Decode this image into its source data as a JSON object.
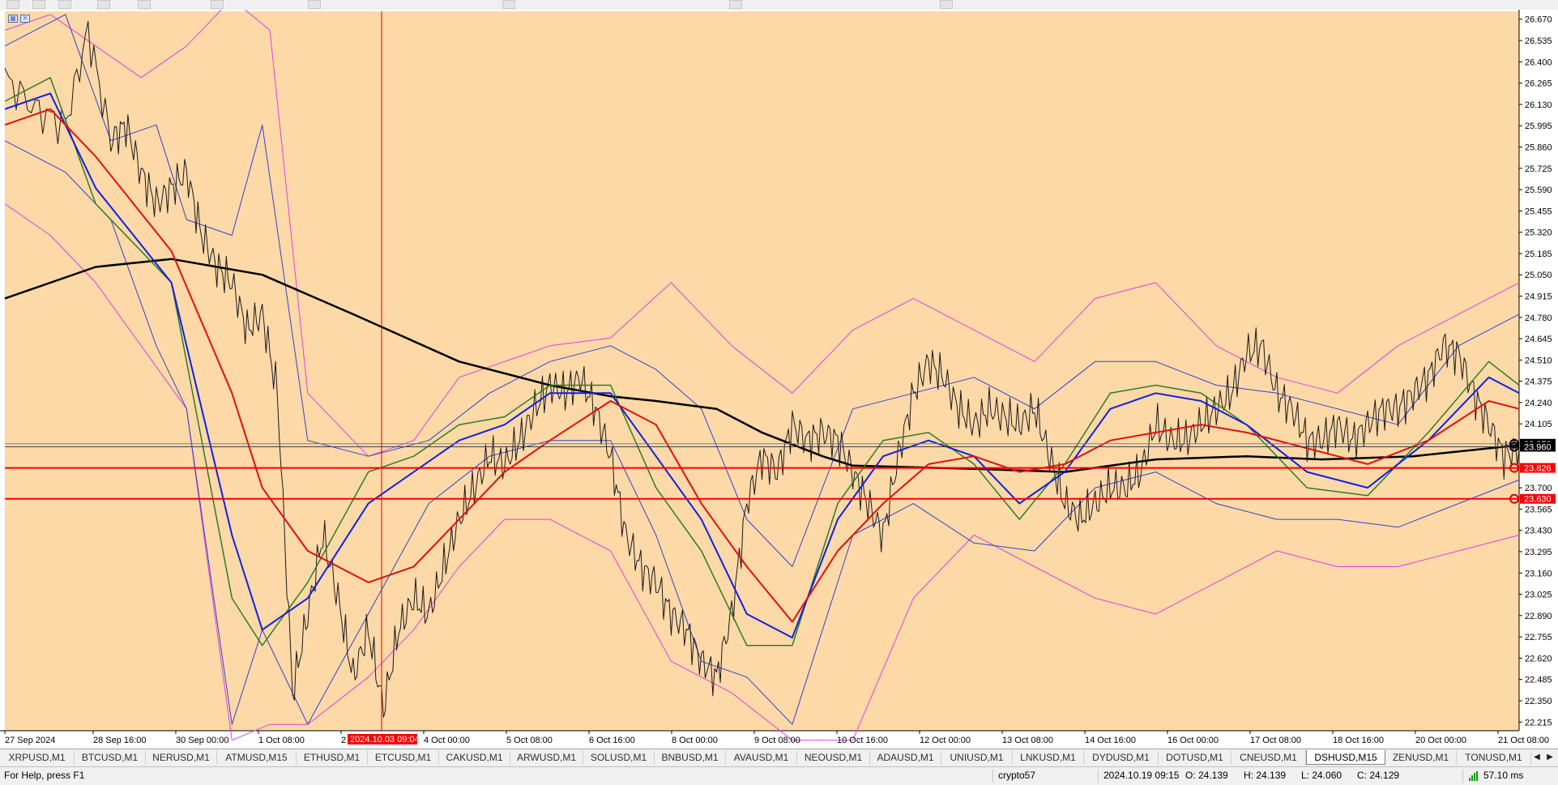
{
  "colors": {
    "chart_bg": "#fdd9a8",
    "price_line": "#1a1a1a",
    "ema_fast_green": "#2e7d1e",
    "ema_blue": "#1020e0",
    "ema_red": "#e01010",
    "sma_black": "#000000",
    "bollinger_inner": "#3040d0",
    "bollinger_outer": "#e040e0",
    "hline_red": "#ff0000",
    "crosshair": "#e00000"
  },
  "chart_data": {
    "type": "line",
    "symbol": "DSHUSD",
    "timeframe": "M15",
    "y_axis_labels": [
      "26.670",
      "26.535",
      "26.400",
      "26.265",
      "26.130",
      "25.995",
      "25.860",
      "25.725",
      "25.590",
      "25.455",
      "25.320",
      "25.185",
      "25.050",
      "24.915",
      "24.780",
      "24.645",
      "24.510",
      "24.375",
      "24.240",
      "24.105",
      "23.700",
      "23.565",
      "23.430",
      "23.295",
      "23.160",
      "23.025",
      "22.890",
      "22.755",
      "22.620",
      "22.485",
      "22.350",
      "22.215"
    ],
    "ylim": [
      22.16,
      26.72
    ],
    "x_axis_labels": [
      "27 Sep 2024",
      "28 Sep 16:00",
      "30 Sep 00:00",
      "1 Oct 08:00",
      "2",
      "4 Oct 00:00",
      "5 Oct 08:00",
      "6 Oct 16:00",
      "8 Oct 00:00",
      "9 Oct 08:00",
      "10 Oct 16:00",
      "12 Oct 00:00",
      "13 Oct 08:00",
      "14 Oct 16:00",
      "16 Oct 00:00",
      "17 Oct 08:00",
      "18 Oct 16:00",
      "20 Oct 00:00",
      "21 Oct 08:00"
    ],
    "price_tags": [
      {
        "label": "23.979",
        "color": "#000000",
        "text_color": "#ffffff"
      },
      {
        "label": "23.960",
        "color": "#000000",
        "text_color": "#ffffff"
      },
      {
        "label": "23.826",
        "color": "#ff0000",
        "text_color": "#ffffff"
      },
      {
        "label": "23.630",
        "color": "#ff0000",
        "text_color": "#ffffff"
      }
    ],
    "horizontal_lines": [
      {
        "price": 23.979,
        "color": "#808080"
      },
      {
        "price": 23.96,
        "color": "#404040"
      },
      {
        "price": 23.826,
        "color": "#ff0000"
      },
      {
        "price": 23.63,
        "color": "#ff0000"
      }
    ],
    "crosshair_label": "2024.10.03 09:04",
    "series": [
      {
        "role": "price",
        "x": [
          0,
          20,
          40,
          55,
          70,
          80,
          90,
          100,
          110,
          120,
          130,
          140,
          150,
          160,
          170,
          180,
          190,
          200,
          210,
          220,
          230,
          240,
          250,
          260,
          270,
          280,
          290,
          300,
          310,
          320,
          330,
          340,
          350,
          360,
          370,
          380,
          390,
          400,
          410,
          420,
          430,
          440,
          450,
          460,
          470,
          480,
          490,
          500,
          510,
          520,
          530,
          540,
          550,
          560,
          570,
          580,
          590,
          600,
          610,
          620,
          630,
          640,
          650,
          660,
          670,
          680,
          690,
          700,
          710,
          720,
          730,
          740,
          750,
          760,
          770,
          780,
          790,
          800,
          810,
          820,
          830,
          840,
          850,
          860,
          870,
          880,
          890,
          900,
          910,
          920,
          930,
          940,
          950,
          960,
          970,
          980,
          990,
          1000
        ],
        "values": [
          26.3,
          26.1,
          26.0,
          26.6,
          25.9,
          26.0,
          25.7,
          25.5,
          25.6,
          25.7,
          25.3,
          25.1,
          25.0,
          24.7,
          24.8,
          24.3,
          22.4,
          22.9,
          23.4,
          23.0,
          22.5,
          22.8,
          22.3,
          22.8,
          23.0,
          22.9,
          23.2,
          23.5,
          23.7,
          23.9,
          23.85,
          24.0,
          24.2,
          24.35,
          24.3,
          24.4,
          24.2,
          23.9,
          23.4,
          23.2,
          23.1,
          22.9,
          22.8,
          22.6,
          22.5,
          22.9,
          23.6,
          23.9,
          23.8,
          24.1,
          24.0,
          24.05,
          24.0,
          23.8,
          23.6,
          23.4,
          23.9,
          24.3,
          24.5,
          24.4,
          24.2,
          24.1,
          24.2,
          24.15,
          24.1,
          24.2,
          23.9,
          23.6,
          23.5,
          23.6,
          23.7,
          23.7,
          23.8,
          24.1,
          24.0,
          24.0,
          24.1,
          24.2,
          24.3,
          24.55,
          24.6,
          24.3,
          24.2,
          24.0,
          24.0,
          24.1,
          24.0,
          24.1,
          24.2,
          24.2,
          24.3,
          24.4,
          24.6,
          24.55,
          24.3,
          24.1,
          23.9,
          23.95
        ]
      },
      {
        "role": "sma_long",
        "x": [
          0,
          60,
          110,
          170,
          230,
          300,
          360,
          400,
          430,
          470,
          500,
          540,
          560,
          600,
          640,
          700,
          760,
          820,
          870,
          930,
          1000
        ],
        "values": [
          24.9,
          25.1,
          25.15,
          25.05,
          24.8,
          24.5,
          24.35,
          24.28,
          24.25,
          24.2,
          24.05,
          23.9,
          23.84,
          23.83,
          23.82,
          23.8,
          23.88,
          23.9,
          23.88,
          23.9,
          23.97
        ]
      },
      {
        "role": "ema_red",
        "x": [
          0,
          30,
          60,
          110,
          150,
          170,
          200,
          240,
          270,
          300,
          330,
          360,
          400,
          430,
          460,
          490,
          520,
          550,
          580,
          610,
          640,
          670,
          700,
          730,
          760,
          790,
          820,
          860,
          900,
          940,
          980,
          1000
        ],
        "values": [
          26.0,
          26.1,
          25.8,
          25.2,
          24.3,
          23.7,
          23.3,
          23.1,
          23.2,
          23.5,
          23.8,
          24.0,
          24.25,
          24.1,
          23.6,
          23.2,
          22.85,
          23.3,
          23.6,
          23.85,
          23.9,
          23.8,
          23.85,
          24.0,
          24.05,
          24.1,
          24.05,
          23.95,
          23.85,
          24.0,
          24.25,
          24.2
        ]
      },
      {
        "role": "ema_blue",
        "x": [
          0,
          30,
          60,
          110,
          150,
          170,
          200,
          240,
          270,
          300,
          330,
          360,
          400,
          430,
          460,
          490,
          520,
          550,
          580,
          610,
          640,
          670,
          700,
          730,
          760,
          790,
          820,
          860,
          900,
          940,
          980,
          1000
        ],
        "values": [
          26.1,
          26.2,
          25.6,
          25.0,
          23.4,
          22.8,
          23.0,
          23.6,
          23.8,
          24.0,
          24.1,
          24.3,
          24.3,
          23.9,
          23.5,
          22.9,
          22.75,
          23.5,
          23.9,
          24.0,
          23.9,
          23.6,
          23.8,
          24.2,
          24.3,
          24.25,
          24.1,
          23.8,
          23.7,
          24.0,
          24.4,
          24.3
        ]
      },
      {
        "role": "ema_green",
        "x": [
          0,
          30,
          60,
          110,
          150,
          170,
          200,
          240,
          270,
          300,
          330,
          360,
          400,
          430,
          460,
          490,
          520,
          550,
          580,
          610,
          640,
          670,
          700,
          730,
          760,
          790,
          820,
          860,
          900,
          940,
          980,
          1000
        ],
        "values": [
          26.15,
          26.3,
          25.5,
          25.0,
          23.0,
          22.7,
          23.1,
          23.8,
          23.9,
          24.1,
          24.15,
          24.35,
          24.35,
          23.7,
          23.3,
          22.7,
          22.7,
          23.6,
          24.0,
          24.05,
          23.85,
          23.5,
          23.85,
          24.3,
          24.35,
          24.3,
          24.1,
          23.7,
          23.65,
          24.05,
          24.5,
          24.35
        ]
      },
      {
        "role": "bollinger_inner_upper",
        "x": [
          0,
          40,
          70,
          100,
          120,
          150,
          170,
          200,
          240,
          280,
          320,
          360,
          400,
          430,
          460,
          490,
          520,
          560,
          600,
          640,
          680,
          720,
          760,
          800,
          840,
          880,
          920,
          960,
          1000
        ],
        "values": [
          26.5,
          26.7,
          25.9,
          26.0,
          25.4,
          25.3,
          26.0,
          24.0,
          23.9,
          24.0,
          24.3,
          24.5,
          24.6,
          24.45,
          24.2,
          23.5,
          23.2,
          24.2,
          24.3,
          24.4,
          24.2,
          24.5,
          24.5,
          24.35,
          24.3,
          24.2,
          24.1,
          24.6,
          24.8
        ]
      },
      {
        "role": "bollinger_inner_lower",
        "x": [
          0,
          40,
          70,
          100,
          120,
          150,
          170,
          200,
          240,
          280,
          320,
          360,
          400,
          430,
          460,
          490,
          520,
          560,
          600,
          640,
          680,
          720,
          760,
          800,
          840,
          880,
          920,
          960,
          1000
        ],
        "values": [
          25.9,
          25.7,
          25.4,
          24.6,
          24.2,
          22.2,
          22.8,
          22.2,
          22.9,
          23.6,
          23.9,
          24.0,
          24.0,
          23.4,
          22.6,
          22.5,
          22.2,
          23.4,
          23.6,
          23.35,
          23.3,
          23.7,
          23.8,
          23.6,
          23.5,
          23.5,
          23.45,
          23.6,
          23.75
        ]
      },
      {
        "role": "bollinger_outer_upper",
        "x": [
          0,
          30,
          60,
          90,
          120,
          150,
          175,
          200,
          240,
          270,
          300,
          330,
          360,
          400,
          440,
          480,
          520,
          560,
          600,
          640,
          680,
          720,
          760,
          800,
          840,
          880,
          920,
          960,
          1000
        ],
        "values": [
          26.6,
          26.7,
          26.5,
          26.3,
          26.5,
          26.8,
          26.6,
          24.3,
          23.9,
          24.0,
          24.4,
          24.5,
          24.6,
          24.65,
          25.0,
          24.6,
          24.3,
          24.7,
          24.9,
          24.7,
          24.5,
          24.9,
          25.0,
          24.6,
          24.4,
          24.3,
          24.6,
          24.8,
          25.0
        ]
      },
      {
        "role": "bollinger_outer_lower",
        "x": [
          0,
          30,
          60,
          90,
          120,
          150,
          175,
          200,
          240,
          270,
          300,
          330,
          360,
          400,
          440,
          480,
          520,
          560,
          600,
          640,
          680,
          720,
          760,
          800,
          840,
          880,
          920,
          960,
          1000
        ],
        "values": [
          25.5,
          25.3,
          25.0,
          24.6,
          24.2,
          22.1,
          22.2,
          22.2,
          22.5,
          22.8,
          23.2,
          23.5,
          23.5,
          23.3,
          22.6,
          22.4,
          22.1,
          22.1,
          23.0,
          23.4,
          23.2,
          23.0,
          22.9,
          23.1,
          23.3,
          23.2,
          23.2,
          23.3,
          23.4
        ]
      }
    ]
  },
  "tabs": [
    {
      "label": "XRPUSD,M1",
      "active": false
    },
    {
      "label": "BTCUSD,M1",
      "active": false
    },
    {
      "label": "NERUSD,M1",
      "active": false
    },
    {
      "label": "ATMUSD,M15",
      "active": false
    },
    {
      "label": "ETHUSD,M1",
      "active": false
    },
    {
      "label": "ETCUSD,M1",
      "active": false
    },
    {
      "label": "CAKUSD,M1",
      "active": false
    },
    {
      "label": "ARWUSD,M1",
      "active": false
    },
    {
      "label": "SOLUSD,M1",
      "active": false
    },
    {
      "label": "BNBUSD,M1",
      "active": false
    },
    {
      "label": "AVAUSD,M1",
      "active": false
    },
    {
      "label": "NEOUSD,M1",
      "active": false
    },
    {
      "label": "ADAUSD,M1",
      "active": false
    },
    {
      "label": "UNIUSD,M1",
      "active": false
    },
    {
      "label": "LNKUSD,M1",
      "active": false
    },
    {
      "label": "DYDUSD,M1",
      "active": false
    },
    {
      "label": "DOTUSD,M1",
      "active": false
    },
    {
      "label": "CNEUSD,M1",
      "active": false
    },
    {
      "label": "DSHUSD,M15",
      "active": true
    },
    {
      "label": "ZENUSD,M1",
      "active": false
    },
    {
      "label": "TONUSD,M1",
      "active": false
    }
  ],
  "status": {
    "help": "For Help, press F1",
    "profile": "crypto57",
    "datetime": "2024.10.19 09:15",
    "open": "O: 24.139",
    "high": "H: 24.139",
    "low": "L: 24.060",
    "close": "C: 24.129",
    "ping": "57.10 ms"
  },
  "icons": {
    "tab_left": "triangle-left-icon",
    "tab_right": "triangle-right-icon",
    "signal": "signal-bars-icon",
    "corner1": "chart-grid-icon",
    "corner2": "chart-close-icon"
  }
}
